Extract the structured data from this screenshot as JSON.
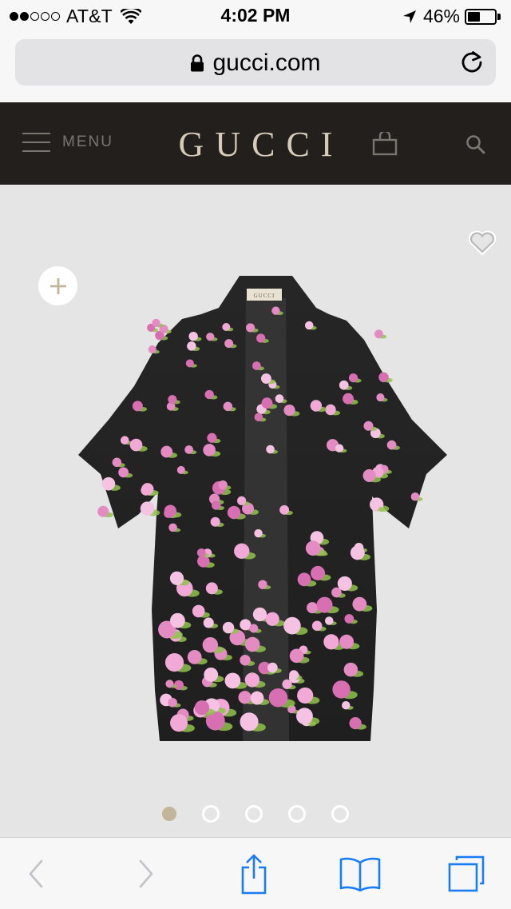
{
  "status_bar": {
    "carrier": "AT&T",
    "time": "4:02 PM",
    "battery_percent": "46%",
    "battery_level": 0.46,
    "signal_bars_filled": 2,
    "signal_bars_total": 5
  },
  "browser": {
    "url": "gucci.com"
  },
  "header": {
    "menu_label": "MENU",
    "logo": "GUCCI"
  },
  "product": {
    "carousel_count": 5,
    "carousel_active_index": 0,
    "garment_label": "GUCCI"
  },
  "colors": {
    "header_bg": "#231f1d",
    "logo_gold": "#d5cbb8",
    "product_bg": "#e5e5e5",
    "ios_blue": "#1a7cf5",
    "carousel_active": "#c2b59b"
  }
}
